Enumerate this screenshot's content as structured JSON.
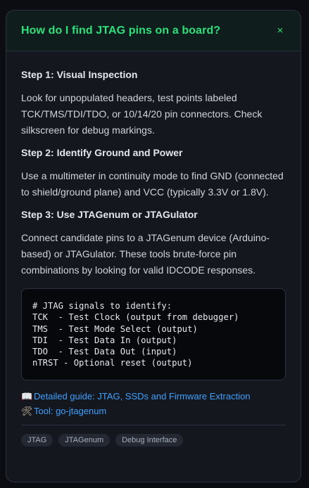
{
  "header": {
    "title": "How do I find JTAG pins on a board?",
    "close_symbol": "×"
  },
  "steps": [
    {
      "heading": "Step 1: Visual Inspection",
      "text": "Look for unpopulated headers, test points labeled TCK/TMS/TDI/TDO, or 10/14/20 pin connectors. Check silkscreen for debug markings."
    },
    {
      "heading": "Step 2: Identify Ground and Power",
      "text": "Use a multimeter in continuity mode to find GND (connected to shield/ground plane) and VCC (typically 3.3V or 1.8V)."
    },
    {
      "heading": "Step 3: Use JTAGenum or JTAGulator",
      "text": "Connect candidate pins to a JTAGenum device (Arduino-based) or JTAGulator. These tools brute-force pin combinations by looking for valid IDCODE responses."
    }
  ],
  "code": {
    "lines": [
      "# JTAG signals to identify:",
      "TCK  - Test Clock (output from debugger)",
      "TMS  - Test Mode Select (output)",
      "TDI  - Test Data In (output)",
      "TDO  - Test Data Out (input)",
      "nTRST - Optional reset (output)"
    ]
  },
  "links": [
    {
      "icon": "book-icon",
      "glyph": "📖",
      "label": "Detailed guide: JTAG, SSDs and Firmware Extraction"
    },
    {
      "icon": "tools-icon",
      "glyph": "🛠",
      "label": "Tool: go-jtagenum"
    }
  ],
  "tags": [
    "JTAG",
    "JTAGenum",
    "Debug Interface"
  ],
  "colors": {
    "accent": "#2ee07a",
    "link": "#3ea0ff",
    "background": "#14171e"
  }
}
